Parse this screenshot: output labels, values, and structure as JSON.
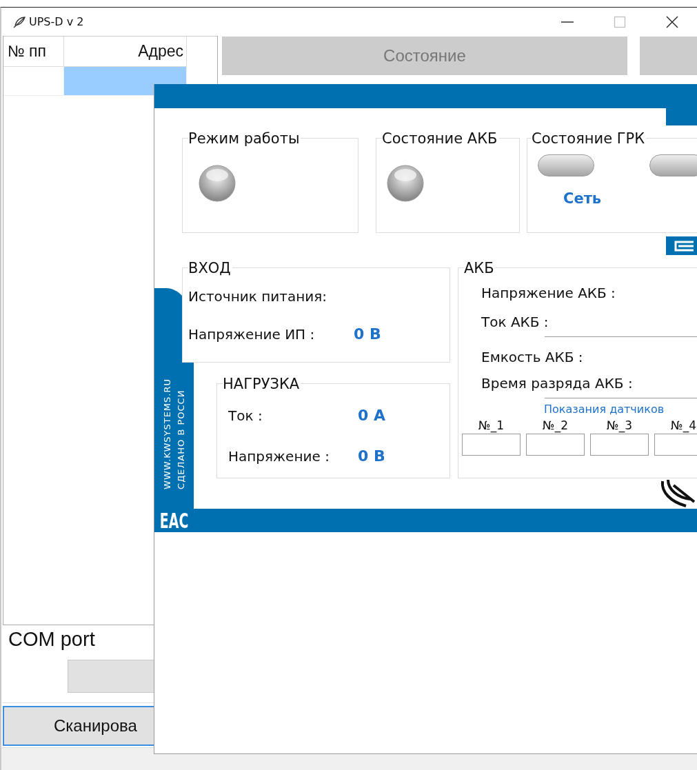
{
  "window": {
    "title": "UPS-D v 2"
  },
  "table": {
    "columns": [
      "№ пп",
      "Адрес"
    ],
    "rows": [
      {
        "selected": true
      }
    ]
  },
  "state_button": {
    "label": "Состояние"
  },
  "com_port": {
    "title": "COM port"
  },
  "scan_button": {
    "label": "Сканирова"
  },
  "dialog": {
    "groups": [
      {
        "title": "Режим работы",
        "kind": "led"
      },
      {
        "title": "Состояние АКБ",
        "kind": "led"
      },
      {
        "title": "Состояние ГРК",
        "kind": "pills",
        "label": "Сеть"
      }
    ],
    "input": {
      "title": "ВХОД",
      "rows": [
        {
          "label": "Источник питания:"
        },
        {
          "label": "Напряжение ИП :",
          "value": "0 В"
        }
      ]
    },
    "load": {
      "title": "НАГРУЗКА",
      "rows": [
        {
          "label": "Ток :",
          "value": "0 А"
        },
        {
          "label": "Напряжение :",
          "value": "0 В"
        }
      ]
    },
    "battery": {
      "title": "АКБ",
      "rows": [
        {
          "label": "Напряжение АКБ :"
        },
        {
          "label": "Ток АКБ :"
        },
        {
          "label": "Емкость АКБ :"
        },
        {
          "label": "Время разряда АКБ :"
        }
      ],
      "sensors_title": "Показания датчиков",
      "sensors": [
        "№_1",
        "№_2",
        "№_3",
        "№_4"
      ]
    },
    "brand": [
      "WWW.KWSYSTEMS.RU",
      "СДЕЛАНО В РОССИ"
    ],
    "mark": "ЕАС"
  }
}
